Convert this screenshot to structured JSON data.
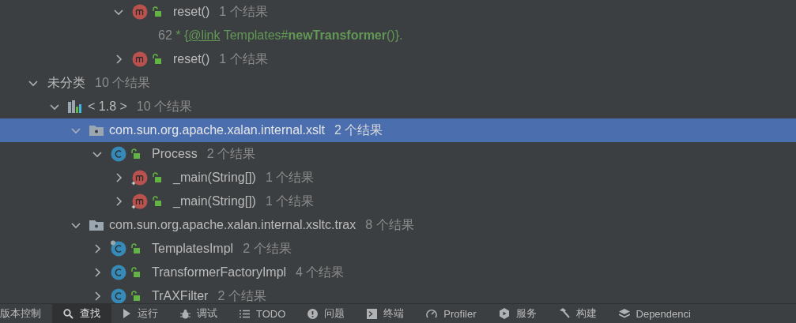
{
  "tree": {
    "partial_top": [
      {
        "kind": "method",
        "label": "reset()",
        "count": "1 个结果",
        "expanded": true,
        "selected": false,
        "children": [
          {
            "kind": "usage",
            "line": "62",
            "selected": false,
            "segments": [
              {
                "kind": "text",
                "text": "* {"
              },
              {
                "kind": "link",
                "text": "@link"
              },
              {
                "kind": "text",
                "text": " Templates#**newTransformer**()}."
              }
            ]
          }
        ]
      },
      {
        "kind": "method",
        "label": "reset()",
        "count": "1 个结果",
        "expanded": false,
        "selected": false
      }
    ],
    "roots": [
      {
        "kind": "category",
        "label": "未分类",
        "count": "10 个结果",
        "expanded": true,
        "selected": false,
        "children": [
          {
            "kind": "sdk",
            "label": "< 1.8 >",
            "count": "10 个结果",
            "expanded": true,
            "selected": false,
            "children": [
              {
                "kind": "package",
                "label": "com.sun.org.apache.xalan.internal.xslt",
                "count": "2 个结果",
                "expanded": true,
                "selected": true,
                "children": [
                  {
                    "kind": "class",
                    "label": "Process",
                    "count": "2 个结果",
                    "expanded": true,
                    "selected": false,
                    "children": [
                      {
                        "kind": "method",
                        "label": "_main(String[])",
                        "count": "1 个结果",
                        "expanded": false,
                        "selected": false,
                        "static": true
                      },
                      {
                        "kind": "method",
                        "label": "_main(String[])",
                        "count": "1 个结果",
                        "expanded": false,
                        "selected": false,
                        "static": true
                      }
                    ]
                  }
                ]
              },
              {
                "kind": "package",
                "label": "com.sun.org.apache.xalan.internal.xsltc.trax",
                "count": "8 个结果",
                "expanded": true,
                "selected": false,
                "children": [
                  {
                    "kind": "class",
                    "label": "TemplatesImpl",
                    "count": "2 个结果",
                    "expanded": false,
                    "selected": false,
                    "badge": true
                  },
                  {
                    "kind": "class",
                    "label": "TransformerFactoryImpl",
                    "count": "4 个结果",
                    "expanded": false,
                    "selected": false
                  },
                  {
                    "kind": "class",
                    "label": "TrAXFilter",
                    "count": "2 个结果",
                    "expanded": false,
                    "selected": false
                  }
                ]
              }
            ]
          }
        ]
      }
    ]
  },
  "tool_window_bar": [
    {
      "label": "版本控制",
      "selected": false
    },
    {
      "label": "查找",
      "selected": true
    },
    {
      "label": "运行",
      "selected": false
    },
    {
      "label": "调试",
      "selected": false
    },
    {
      "label": "TODO",
      "selected": false
    },
    {
      "label": "问题",
      "selected": false
    },
    {
      "label": "终端",
      "selected": false
    },
    {
      "label": "Profiler",
      "selected": false
    },
    {
      "label": "服务",
      "selected": false
    },
    {
      "label": "构建",
      "selected": false
    },
    {
      "label": "Dependenci",
      "selected": false
    }
  ]
}
